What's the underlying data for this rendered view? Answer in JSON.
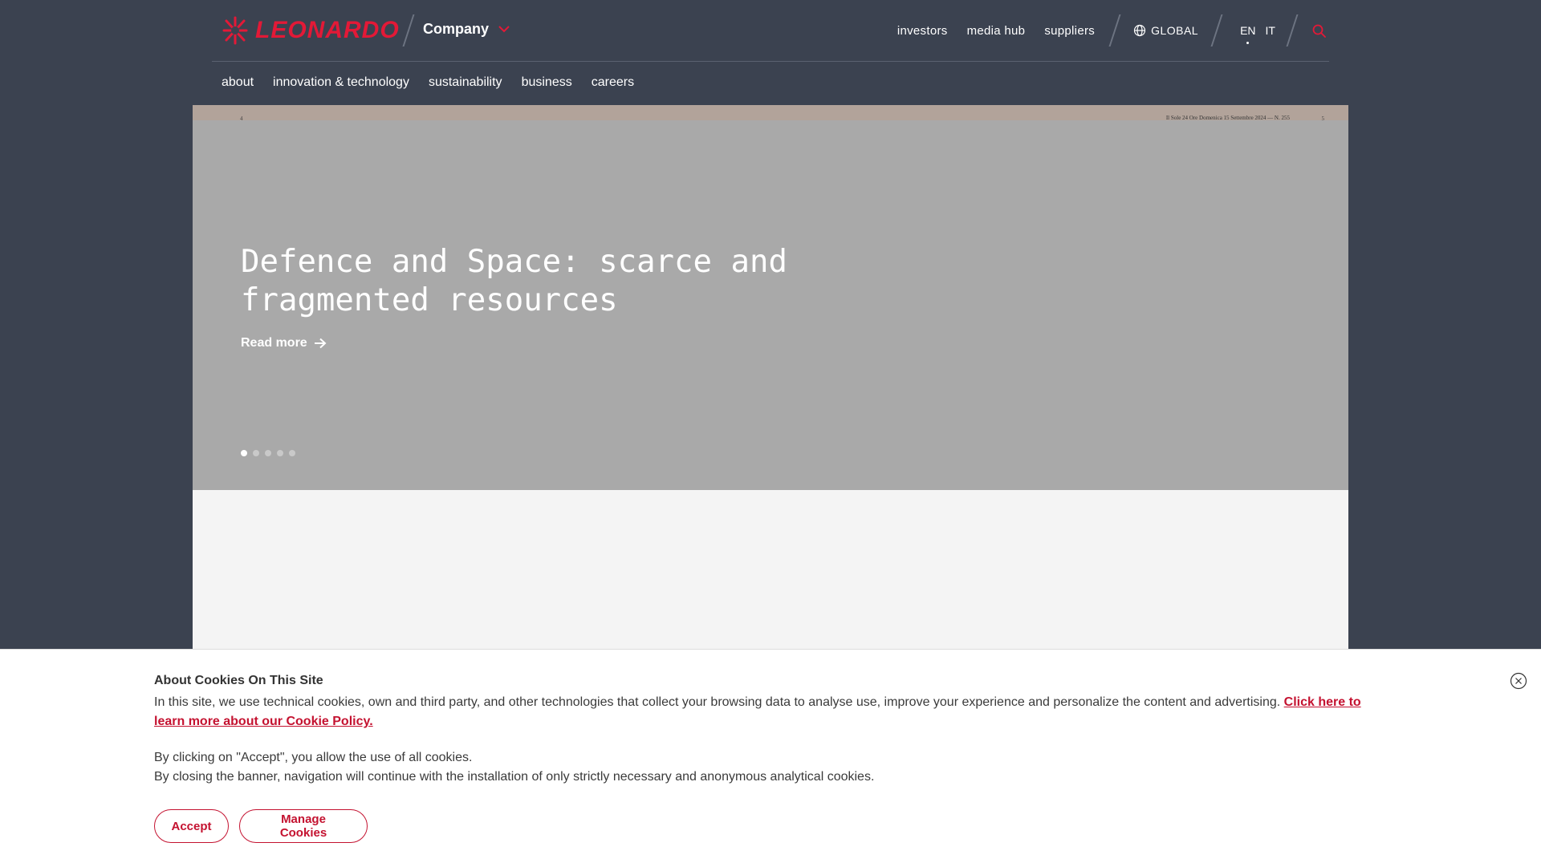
{
  "header": {
    "logo_text": "LEONARDO",
    "company_label": "Company",
    "utility_links": [
      {
        "label": "investors"
      },
      {
        "label": "media hub"
      },
      {
        "label": "suppliers"
      }
    ],
    "region_label": "GLOBAL",
    "languages": [
      {
        "code": "EN",
        "active": true
      },
      {
        "code": "IT",
        "active": false
      }
    ],
    "icons": {
      "logo": "leonardo-sunburst-icon",
      "company_dropdown": "chevron-down-icon",
      "region": "globe-icon",
      "search": "search-icon"
    },
    "brand_color": "#e31937"
  },
  "nav": {
    "items": [
      {
        "label": "about"
      },
      {
        "label": "innovation & technology"
      },
      {
        "label": "sustainability"
      },
      {
        "label": "business"
      },
      {
        "label": "careers"
      }
    ]
  },
  "hero": {
    "strip_page_left": "4",
    "strip_masthead": "Il Sole 24 Ore Domenica 15 Settembre 2024 — N. 255",
    "strip_page_right": "5",
    "title": "Defence and Space: scarce and fragmented resources",
    "read_more": "Read more",
    "slides_total": 5,
    "active_slide": 1,
    "background_color": "#a9a9a9"
  },
  "cookie_banner": {
    "title": "About Cookies On This Site",
    "text": "In this site, we use technical cookies, own and third party, and other technologies that collect your browsing data to analyse use, improve your experience and personalize the content and advertising.",
    "policy_link": "Click here to learn more about our Cookie Policy.",
    "accept_note": "By clicking on \"Accept\", you allow the use of all cookies.",
    "close_note": "By closing the banner, navigation will continue with the installation of only strictly necessary and anonymous analytical cookies.",
    "accept_label": "Accept",
    "manage_label": "Manage Cookies",
    "accent_color": "#c41230"
  }
}
